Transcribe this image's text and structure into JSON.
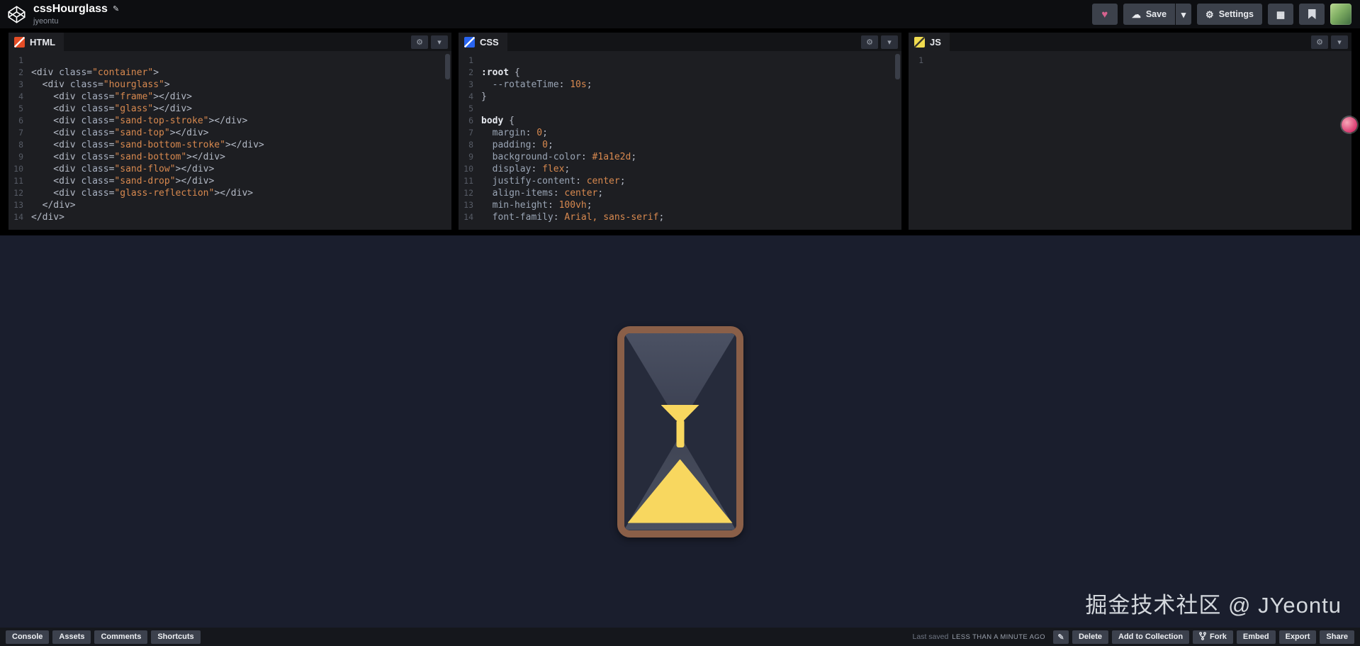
{
  "header": {
    "title": "cssHourglass",
    "author": "jyeontu",
    "save_label": "Save",
    "settings_label": "Settings"
  },
  "icons": {
    "heart": "♥",
    "cloud": "☁",
    "chevron_down": "▾",
    "gear": "⚙",
    "pencil": "✎",
    "grid": "▦"
  },
  "editors": [
    {
      "label": "HTML",
      "lines": [
        [],
        [
          [
            "t",
            "<div "
          ],
          [
            "a",
            "class"
          ],
          [
            "t",
            "="
          ],
          [
            "s",
            "\"container\""
          ],
          [
            "t",
            ">"
          ]
        ],
        [
          [
            "t",
            "  <div "
          ],
          [
            "a",
            "class"
          ],
          [
            "t",
            "="
          ],
          [
            "s",
            "\"hourglass\""
          ],
          [
            "t",
            ">"
          ]
        ],
        [
          [
            "t",
            "    <div "
          ],
          [
            "a",
            "class"
          ],
          [
            "t",
            "="
          ],
          [
            "s",
            "\"frame\""
          ],
          [
            "t",
            "></div>"
          ]
        ],
        [
          [
            "t",
            "    <div "
          ],
          [
            "a",
            "class"
          ],
          [
            "t",
            "="
          ],
          [
            "s",
            "\"glass\""
          ],
          [
            "t",
            "></div>"
          ]
        ],
        [
          [
            "t",
            "    <div "
          ],
          [
            "a",
            "class"
          ],
          [
            "t",
            "="
          ],
          [
            "s",
            "\"sand-top-stroke\""
          ],
          [
            "t",
            "></div>"
          ]
        ],
        [
          [
            "t",
            "    <div "
          ],
          [
            "a",
            "class"
          ],
          [
            "t",
            "="
          ],
          [
            "s",
            "\"sand-top\""
          ],
          [
            "t",
            "></div>"
          ]
        ],
        [
          [
            "t",
            "    <div "
          ],
          [
            "a",
            "class"
          ],
          [
            "t",
            "="
          ],
          [
            "s",
            "\"sand-bottom-stroke\""
          ],
          [
            "t",
            "></div>"
          ]
        ],
        [
          [
            "t",
            "    <div "
          ],
          [
            "a",
            "class"
          ],
          [
            "t",
            "="
          ],
          [
            "s",
            "\"sand-bottom\""
          ],
          [
            "t",
            "></div>"
          ]
        ],
        [
          [
            "t",
            "    <div "
          ],
          [
            "a",
            "class"
          ],
          [
            "t",
            "="
          ],
          [
            "s",
            "\"sand-flow\""
          ],
          [
            "t",
            "></div>"
          ]
        ],
        [
          [
            "t",
            "    <div "
          ],
          [
            "a",
            "class"
          ],
          [
            "t",
            "="
          ],
          [
            "s",
            "\"sand-drop\""
          ],
          [
            "t",
            "></div>"
          ]
        ],
        [
          [
            "t",
            "    <div "
          ],
          [
            "a",
            "class"
          ],
          [
            "t",
            "="
          ],
          [
            "s",
            "\"glass-reflection\""
          ],
          [
            "t",
            "></div>"
          ]
        ],
        [
          [
            "t",
            "  </div>"
          ]
        ],
        [
          [
            "t",
            "</div>"
          ]
        ]
      ]
    },
    {
      "label": "CSS",
      "lines": [
        [],
        [
          [
            "sel",
            ":root"
          ],
          [
            "t",
            " {"
          ]
        ],
        [
          [
            "t",
            "  "
          ],
          [
            "p",
            "--rotateTime"
          ],
          [
            "t",
            ": "
          ],
          [
            "v",
            "10s"
          ],
          [
            "t",
            ";"
          ]
        ],
        [
          [
            "t",
            "}"
          ]
        ],
        [],
        [
          [
            "sel",
            "body"
          ],
          [
            "t",
            " {"
          ]
        ],
        [
          [
            "t",
            "  "
          ],
          [
            "p",
            "margin"
          ],
          [
            "t",
            ": "
          ],
          [
            "v",
            "0"
          ],
          [
            "t",
            ";"
          ]
        ],
        [
          [
            "t",
            "  "
          ],
          [
            "p",
            "padding"
          ],
          [
            "t",
            ": "
          ],
          [
            "v",
            "0"
          ],
          [
            "t",
            ";"
          ]
        ],
        [
          [
            "t",
            "  "
          ],
          [
            "p",
            "background-color"
          ],
          [
            "t",
            ": "
          ],
          [
            "v",
            "#1a1e2d"
          ],
          [
            "t",
            ";"
          ]
        ],
        [
          [
            "t",
            "  "
          ],
          [
            "p",
            "display"
          ],
          [
            "t",
            ": "
          ],
          [
            "v",
            "flex"
          ],
          [
            "t",
            ";"
          ]
        ],
        [
          [
            "t",
            "  "
          ],
          [
            "p",
            "justify-content"
          ],
          [
            "t",
            ": "
          ],
          [
            "v",
            "center"
          ],
          [
            "t",
            ";"
          ]
        ],
        [
          [
            "t",
            "  "
          ],
          [
            "p",
            "align-items"
          ],
          [
            "t",
            ": "
          ],
          [
            "v",
            "center"
          ],
          [
            "t",
            ";"
          ]
        ],
        [
          [
            "t",
            "  "
          ],
          [
            "p",
            "min-height"
          ],
          [
            "t",
            ": "
          ],
          [
            "v",
            "100vh"
          ],
          [
            "t",
            ";"
          ]
        ],
        [
          [
            "t",
            "  "
          ],
          [
            "p",
            "font-family"
          ],
          [
            "t",
            ": "
          ],
          [
            "v",
            "Arial, sans-serif"
          ],
          [
            "t",
            ";"
          ]
        ]
      ]
    },
    {
      "label": "JS",
      "lines": [
        []
      ]
    }
  ],
  "preview": {
    "watermark": "掘金技术社区 @ JYeontu",
    "background": "#1a1e2d",
    "frame_color": "#8a5f48",
    "sand_color": "#f8d75f"
  },
  "footer": {
    "left": [
      "Console",
      "Assets",
      "Comments",
      "Shortcuts"
    ],
    "saved_prefix": "Last saved",
    "saved_time": "LESS THAN A MINUTE AGO",
    "right": [
      "Delete",
      "Add to Collection",
      "Fork",
      "Embed",
      "Export",
      "Share"
    ]
  }
}
